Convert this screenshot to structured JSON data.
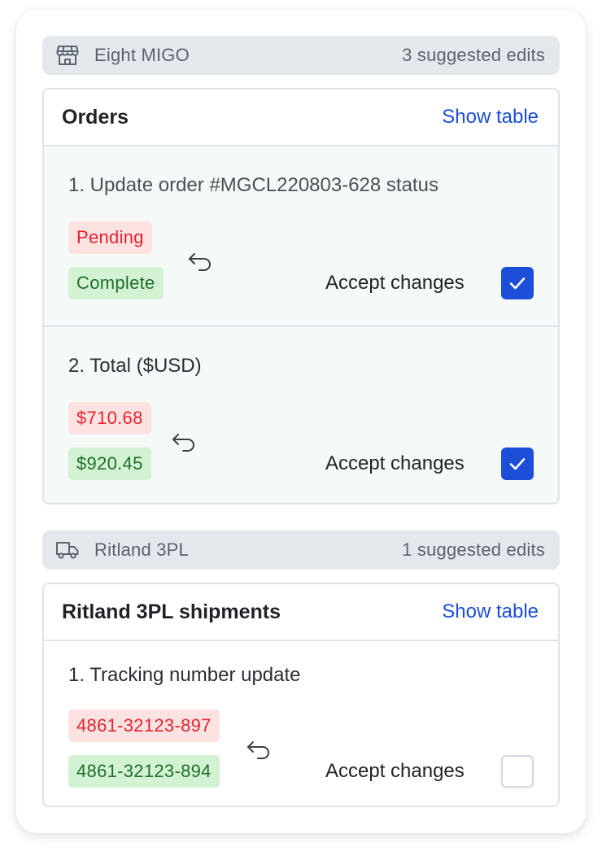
{
  "groups": [
    {
      "icon": "storefront-icon",
      "name": "Eight MIGO",
      "count": "3 suggested edits",
      "panel": {
        "title": "Orders",
        "show_table": "Show table",
        "edits": [
          {
            "title": "1. Update order #MGCL220803-628 status",
            "old": "Pending",
            "new": "Complete",
            "accept_label": "Accept changes",
            "checked": true
          },
          {
            "title": "2. Total ($USD)",
            "old": "$710.68",
            "new": "$920.45",
            "accept_label": "Accept changes",
            "checked": true
          }
        ]
      }
    },
    {
      "icon": "truck-icon",
      "name": "Ritland 3PL",
      "count": "1 suggested edits",
      "panel": {
        "title": "Ritland 3PL shipments",
        "show_table": "Show table",
        "edits": [
          {
            "title": "1. Tracking number update",
            "old": "4861-32123-897",
            "new": "4861-32123-894",
            "accept_label": "Accept changes",
            "checked": false
          }
        ]
      }
    }
  ],
  "colors": {
    "accent": "#1d4ed8",
    "old_bg": "#fde2e2",
    "old_text": "#e5232e",
    "new_bg": "#d3f2d3",
    "new_text": "#1f6f2a"
  }
}
